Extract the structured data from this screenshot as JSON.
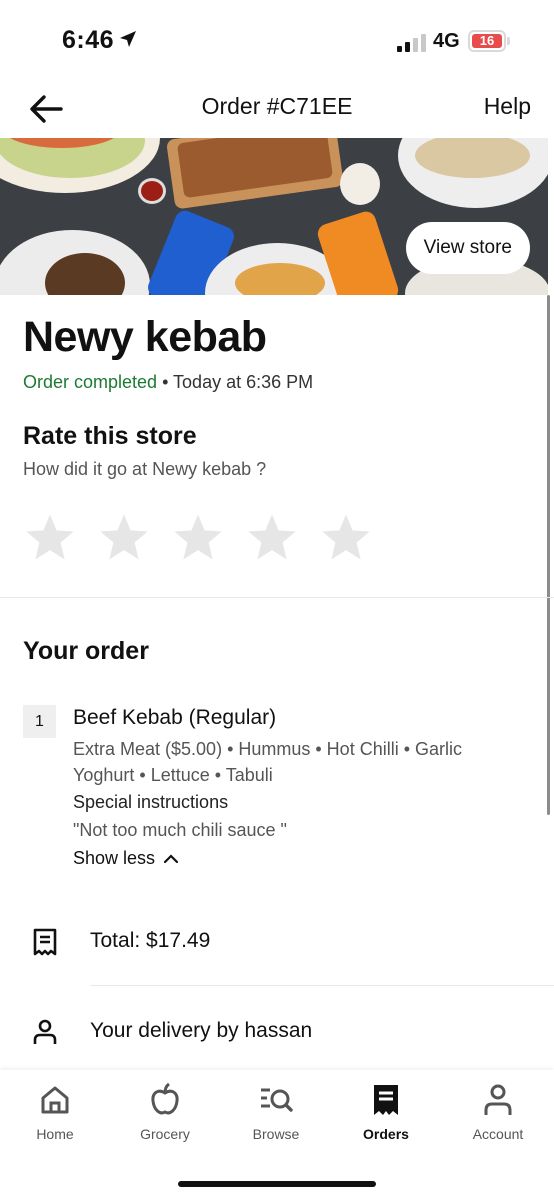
{
  "status_bar": {
    "time": "6:46",
    "network": "4G",
    "battery": "16"
  },
  "header": {
    "title": "Order #C71EE",
    "help": "Help"
  },
  "hero": {
    "view_store": "View store"
  },
  "store": {
    "name": "Newy kebab",
    "status": "Order completed",
    "time": " • Today at 6:36 PM"
  },
  "rating": {
    "title": "Rate this store",
    "subtitle": "How did it go at Newy kebab ?",
    "stars": 5
  },
  "order": {
    "title": "Your order",
    "items": [
      {
        "qty": "1",
        "name": "Beef Kebab (Regular)",
        "modifiers": "Extra Meat ($5.00) • Hummus • Hot Chilli • Garlic Yoghurt • Lettuce • Tabuli",
        "special_label": "Special instructions",
        "special_text": "\"Not too much chili sauce \"",
        "toggle": "Show less"
      }
    ],
    "total": "Total: $17.49",
    "delivery": "Your delivery by hassan"
  },
  "nav": {
    "items": [
      {
        "label": "Home",
        "icon": "home-icon"
      },
      {
        "label": "Grocery",
        "icon": "grocery-icon"
      },
      {
        "label": "Browse",
        "icon": "browse-icon"
      },
      {
        "label": "Orders",
        "icon": "orders-icon"
      },
      {
        "label": "Account",
        "icon": "account-icon"
      }
    ],
    "active": "Orders"
  },
  "colors": {
    "success": "#1d7a32",
    "star_empty": "#e6e6e6",
    "battery_low": "#e84b4b"
  }
}
